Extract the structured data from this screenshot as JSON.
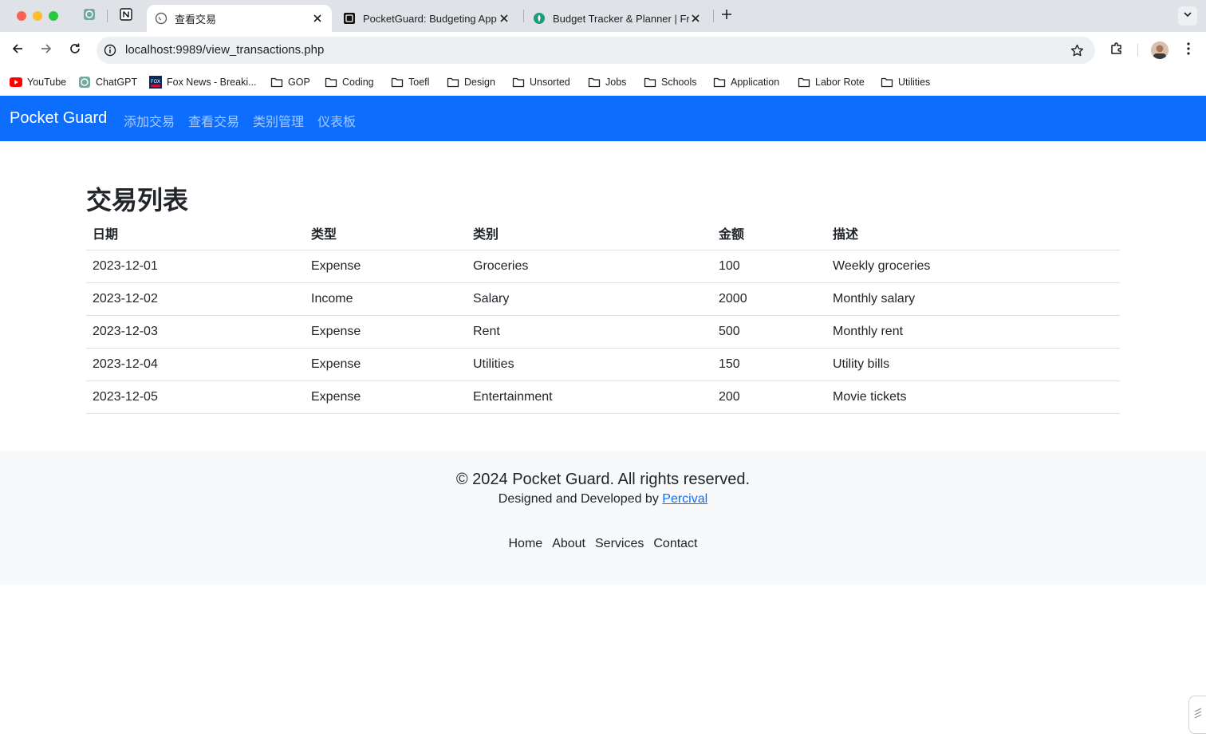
{
  "browser": {
    "tabs": [
      {
        "title": "",
        "favicon": "chatgpt-icon"
      },
      {
        "title": "",
        "favicon": "notion-icon"
      },
      {
        "title": "查看交易",
        "favicon": "globe-icon",
        "active": true
      },
      {
        "title": "PocketGuard: Budgeting App",
        "favicon": "pocketguard-icon"
      },
      {
        "title": "Budget Tracker & Planner | Fr",
        "favicon": "budget-tracker-icon"
      }
    ],
    "url": "localhost:9989/view_transactions.php",
    "bookmarks": [
      {
        "label": "YouTube",
        "icon": "youtube-icon"
      },
      {
        "label": "ChatGPT",
        "icon": "chatgpt-icon"
      },
      {
        "label": "Fox News - Breaki...",
        "icon": "fox-news-icon"
      },
      {
        "label": "GOP",
        "icon": "folder-icon"
      },
      {
        "label": "Coding",
        "icon": "folder-icon"
      },
      {
        "label": "Toefl",
        "icon": "folder-icon"
      },
      {
        "label": "Design",
        "icon": "folder-icon"
      },
      {
        "label": "Unsorted",
        "icon": "folder-icon"
      },
      {
        "label": "Jobs",
        "icon": "folder-icon"
      },
      {
        "label": "Schools",
        "icon": "folder-icon"
      },
      {
        "label": "Application",
        "icon": "folder-icon"
      },
      {
        "label": "Labor Rote",
        "icon": "folder-icon"
      },
      {
        "label": "Utilities",
        "icon": "folder-icon"
      }
    ]
  },
  "navbar": {
    "brand": "Pocket Guard",
    "links": [
      "添加交易",
      "查看交易",
      "类别管理",
      "仪表板"
    ],
    "color": "#0d6efd"
  },
  "main": {
    "title": "交易列表",
    "table": {
      "headers": [
        "日期",
        "类型",
        "类别",
        "金额",
        "描述"
      ],
      "rows": [
        [
          "2023-12-01",
          "Expense",
          "Groceries",
          "100",
          "Weekly groceries"
        ],
        [
          "2023-12-02",
          "Income",
          "Salary",
          "2000",
          "Monthly salary"
        ],
        [
          "2023-12-03",
          "Expense",
          "Rent",
          "500",
          "Monthly rent"
        ],
        [
          "2023-12-04",
          "Expense",
          "Utilities",
          "150",
          "Utility bills"
        ],
        [
          "2023-12-05",
          "Expense",
          "Entertainment",
          "200",
          "Movie tickets"
        ]
      ]
    }
  },
  "footer": {
    "copyright": "© 2024 Pocket Guard. All rights reserved.",
    "credit_prefix": "Designed and Developed by ",
    "credit_link": "Percival",
    "links": [
      "Home",
      "About",
      "Services",
      "Contact"
    ]
  }
}
